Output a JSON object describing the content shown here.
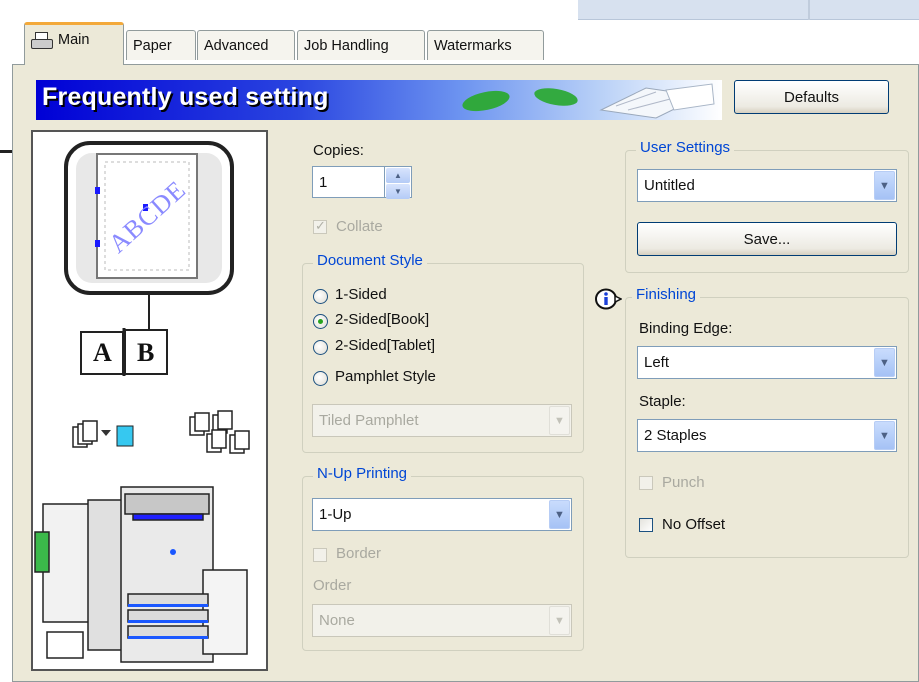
{
  "tabs": [
    {
      "label": "Main",
      "icon": "printer-icon",
      "active": true
    },
    {
      "label": "Paper"
    },
    {
      "label": "Advanced"
    },
    {
      "label": "Job Handling"
    },
    {
      "label": "Watermarks"
    }
  ],
  "banner": {
    "title": "Frequently used setting"
  },
  "defaults_button": "Defaults",
  "preview": {
    "sample_text": "ABCDE",
    "booklet_left": "A",
    "booklet_right": "B"
  },
  "copies": {
    "label": "Copies:",
    "value": "1"
  },
  "collate": {
    "label": "Collate",
    "checked": true,
    "disabled": true
  },
  "document_style": {
    "legend": "Document Style",
    "options": [
      "1-Sided",
      "2-Sided[Book]",
      "2-Sided[Tablet]",
      "Pamphlet Style"
    ],
    "selected": "2-Sided[Book]",
    "pamphlet_select": "Tiled Pamphlet"
  },
  "nup": {
    "legend": "N-Up Printing",
    "value": "1-Up",
    "border_label": "Border",
    "order_label": "Order",
    "order_value": "None"
  },
  "user_settings": {
    "legend": "User Settings",
    "value": "Untitled",
    "save_button": "Save..."
  },
  "finishing": {
    "legend": "Finishing",
    "binding_edge_label": "Binding Edge:",
    "binding_edge_value": "Left",
    "staple_label": "Staple:",
    "staple_value": "2 Staples",
    "punch_label": "Punch",
    "no_offset_label": "No Offset"
  },
  "colors": {
    "banner_blue": "#0000d6",
    "legend_blue": "#0046d5",
    "tab_accent": "#f3a93a",
    "panel_bg": "#ece9d8"
  }
}
